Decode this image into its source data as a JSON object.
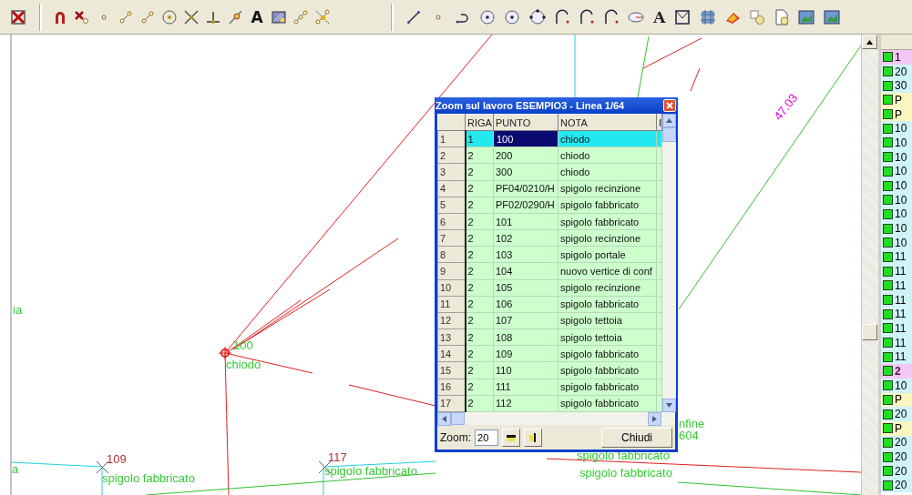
{
  "toolbar": {
    "groups": [
      {
        "items": [
          {
            "kind": "delete"
          }
        ]
      },
      {
        "items": [
          {
            "kind": "magnet"
          },
          {
            "kind": "xpoint"
          },
          {
            "kind": "dot"
          },
          {
            "kind": "segment"
          },
          {
            "kind": "segment"
          },
          {
            "kind": "circlepoint"
          },
          {
            "kind": "cross"
          },
          {
            "kind": "perp"
          },
          {
            "kind": "pen"
          },
          {
            "kind": "text",
            "label": "A"
          },
          {
            "kind": "hatch"
          },
          {
            "kind": "points"
          },
          {
            "kind": "snap"
          }
        ]
      },
      {
        "items": [
          {
            "kind": "line"
          },
          {
            "kind": "dot"
          },
          {
            "kind": "hook"
          },
          {
            "kind": "circle"
          },
          {
            "kind": "circle"
          },
          {
            "kind": "circlenodes"
          },
          {
            "kind": "arc"
          },
          {
            "kind": "arc"
          },
          {
            "kind": "arc"
          },
          {
            "kind": "ellipse"
          },
          {
            "kind": "text",
            "label": "A"
          },
          {
            "kind": "frame"
          },
          {
            "kind": "grid"
          },
          {
            "kind": "paint"
          },
          {
            "kind": "shapes"
          },
          {
            "kind": "doc"
          },
          {
            "kind": "image"
          },
          {
            "kind": "image"
          }
        ]
      }
    ]
  },
  "canvas": {
    "labels": [
      {
        "text": "ia",
        "color": "#33cc33"
      },
      {
        "text": "100",
        "color": "#33cc33"
      },
      {
        "text": "chiodo",
        "color": "#33cc33"
      },
      {
        "text": "a",
        "color": "#33cc33"
      },
      {
        "text": "109",
        "color": "#b03030"
      },
      {
        "text": "spigolo fabbricato",
        "color": "#33cc33"
      },
      {
        "text": "117",
        "color": "#b03030"
      },
      {
        "text": "spigolo fabbricato",
        "color": "#33cc33"
      },
      {
        "text": "47.03",
        "color": "#dd00dd"
      },
      {
        "text": "nfine",
        "color": "#33cc33"
      },
      {
        "text": "604",
        "color": "#33cc33"
      },
      {
        "text": "spigolo fabbricato",
        "color": "#33cc33"
      },
      {
        "text": "spigolo fabbricato",
        "color": "#33cc33"
      }
    ]
  },
  "dialog": {
    "title": "Zoom sul lavoro ESEMPIO3 - Linea 1/64",
    "table": {
      "columns": [
        "RIGA",
        "PUNTO",
        "NOTA",
        "I"
      ],
      "rows": [
        {
          "number": "1",
          "riga": "1",
          "punto": "100",
          "nota": "chiodo",
          "selected": true,
          "focused": true
        },
        {
          "number": "2",
          "riga": "2",
          "punto": "200",
          "nota": "chiodo",
          "selected": false,
          "focused": false
        },
        {
          "number": "3",
          "riga": "2",
          "punto": "300",
          "nota": "chiodo",
          "selected": false,
          "focused": false
        },
        {
          "number": "4",
          "riga": "2",
          "punto": "PF04/0210/H",
          "nota": "spigolo recinzione",
          "selected": false,
          "focused": false
        },
        {
          "number": "5",
          "riga": "2",
          "punto": "PF02/0290/H",
          "nota": "spigolo fabbricato",
          "selected": false,
          "focused": false
        },
        {
          "number": "6",
          "riga": "2",
          "punto": "101",
          "nota": "spigolo fabbricato",
          "selected": false,
          "focused": false
        },
        {
          "number": "7",
          "riga": "2",
          "punto": "102",
          "nota": "spigolo recinzione",
          "selected": false,
          "focused": false
        },
        {
          "number": "8",
          "riga": "2",
          "punto": "103",
          "nota": "spigolo portale",
          "selected": false,
          "focused": false
        },
        {
          "number": "9",
          "riga": "2",
          "punto": "104",
          "nota": "nuovo vertice di conf",
          "selected": false,
          "focused": false
        },
        {
          "number": "10",
          "riga": "2",
          "punto": "105",
          "nota": "spigolo recinzione",
          "selected": false,
          "focused": false
        },
        {
          "number": "11",
          "riga": "2",
          "punto": "106",
          "nota": "spigolo fabbricato",
          "selected": false,
          "focused": false
        },
        {
          "number": "12",
          "riga": "2",
          "punto": "107",
          "nota": "spigolo tettoia",
          "selected": false,
          "focused": false
        },
        {
          "number": "13",
          "riga": "2",
          "punto": "108",
          "nota": "spigolo tettoia",
          "selected": false,
          "focused": false
        },
        {
          "number": "14",
          "riga": "2",
          "punto": "109",
          "nota": "spigolo fabbricato",
          "selected": false,
          "focused": false
        },
        {
          "number": "15",
          "riga": "2",
          "punto": "110",
          "nota": "spigolo fabbricato",
          "selected": false,
          "focused": false
        },
        {
          "number": "16",
          "riga": "2",
          "punto": "111",
          "nota": "spigolo fabbricato",
          "selected": false,
          "focused": false
        },
        {
          "number": "17",
          "riga": "2",
          "punto": "112",
          "nota": "spigolo fabbricato",
          "selected": false,
          "focused": false
        }
      ]
    },
    "zoom_label": "Zoom:",
    "zoom_value": "20",
    "close_button": "Chiudi"
  },
  "point_list": {
    "items": [
      {
        "text": "1",
        "color": "#f4c8f4",
        "bold": false
      },
      {
        "text": "20",
        "color": "#cff4f8",
        "bold": false
      },
      {
        "text": "30",
        "color": "#cff4f8",
        "bold": false
      },
      {
        "text": "P",
        "color": "#fbf6c0",
        "bold": false
      },
      {
        "text": "P",
        "color": "#fbf6c0",
        "bold": false
      },
      {
        "text": "10",
        "color": "#cff4f8",
        "bold": false
      },
      {
        "text": "10",
        "color": "#cff4f8",
        "bold": false
      },
      {
        "text": "10",
        "color": "#cff4f8",
        "bold": false
      },
      {
        "text": "10",
        "color": "#cff4f8",
        "bold": false
      },
      {
        "text": "10",
        "color": "#cff4f8",
        "bold": false
      },
      {
        "text": "10",
        "color": "#cff4f8",
        "bold": false
      },
      {
        "text": "10",
        "color": "#cff4f8",
        "bold": false
      },
      {
        "text": "10",
        "color": "#cff4f8",
        "bold": false
      },
      {
        "text": "10",
        "color": "#cff4f8",
        "bold": false
      },
      {
        "text": "11",
        "color": "#cff4f8",
        "bold": false
      },
      {
        "text": "11",
        "color": "#cff4f8",
        "bold": false
      },
      {
        "text": "11",
        "color": "#cff4f8",
        "bold": false
      },
      {
        "text": "11",
        "color": "#cff4f8",
        "bold": false
      },
      {
        "text": "11",
        "color": "#cff4f8",
        "bold": false
      },
      {
        "text": "11",
        "color": "#cff4f8",
        "bold": false
      },
      {
        "text": "11",
        "color": "#cff4f8",
        "bold": false
      },
      {
        "text": "11",
        "color": "#cff4f8",
        "bold": false
      },
      {
        "text": "2",
        "color": "#f4c8f4",
        "bold": true
      },
      {
        "text": "10",
        "color": "#cff4f8",
        "bold": false
      },
      {
        "text": "P",
        "color": "#fbf6c0",
        "bold": false
      },
      {
        "text": "20",
        "color": "#cff4f8",
        "bold": false
      },
      {
        "text": "P",
        "color": "#fbf6c0",
        "bold": false
      },
      {
        "text": "20",
        "color": "#cff4f8",
        "bold": false
      },
      {
        "text": "20",
        "color": "#cff4f8",
        "bold": false
      },
      {
        "text": "20",
        "color": "#cff4f8",
        "bold": false
      },
      {
        "text": "20",
        "color": "#cff4f8",
        "bold": false
      }
    ]
  }
}
